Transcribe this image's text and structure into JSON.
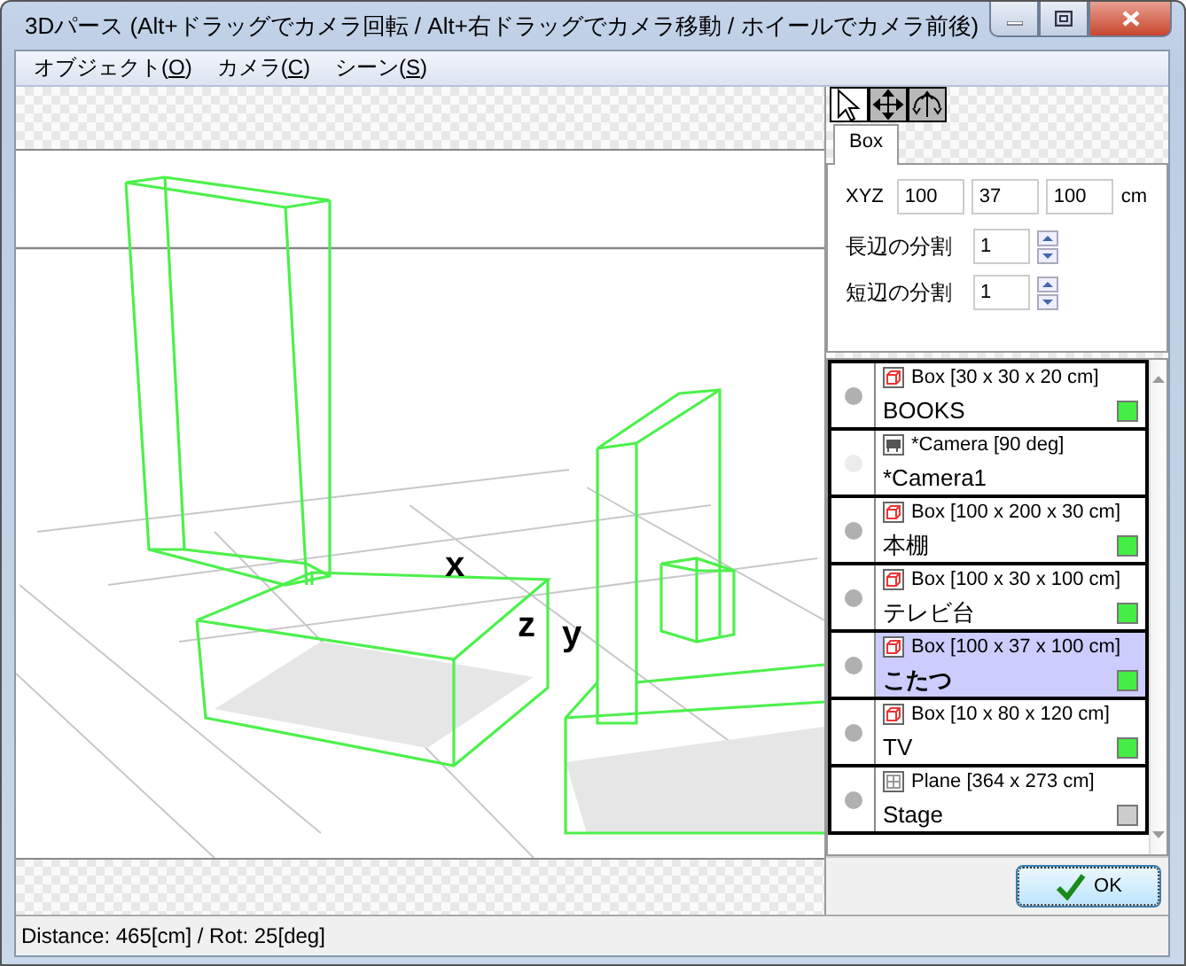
{
  "window": {
    "title": "3Dパース (Alt+ドラッグでカメラ回転 / Alt+右ドラッグでカメラ移動 / ホイールでカメラ前後)"
  },
  "menu": [
    {
      "before": "オブジェクト(",
      "key": "O",
      "after": ")"
    },
    {
      "before": "カメラ(",
      "key": "C",
      "after": ")"
    },
    {
      "before": "シーン(",
      "key": "S",
      "after": ")"
    }
  ],
  "viewport": {
    "axis_labels": [
      "x",
      "z",
      "y"
    ]
  },
  "tools": [
    {
      "kind": "select",
      "selected": true
    },
    {
      "kind": "move",
      "selected": false
    },
    {
      "kind": "rotate",
      "selected": false
    }
  ],
  "properties": {
    "tab": {
      "label": "Box",
      "selected": true
    },
    "xyz_label": "XYZ",
    "xyz": [
      "100",
      "37",
      "100"
    ],
    "unit": "cm",
    "spinners": [
      {
        "label": "長辺の分割",
        "value": "1"
      },
      {
        "label": "短辺の分割",
        "value": "1"
      }
    ]
  },
  "objects": [
    {
      "kind": "box",
      "title": "Box [30 x 30 x 20 cm]",
      "name": "BOOKS",
      "color": "#44ee44",
      "visible": true,
      "selected": false
    },
    {
      "kind": "camera",
      "title": "*Camera [90 deg]",
      "name": "*Camera1",
      "visible": false,
      "selected": false
    },
    {
      "kind": "box",
      "title": "Box [100 x 200 x 30 cm]",
      "name": "本棚",
      "color": "#44ee44",
      "visible": true,
      "selected": false
    },
    {
      "kind": "box",
      "title": "Box [100 x 30 x 100 cm]",
      "name": "テレビ台",
      "color": "#44ee44",
      "visible": true,
      "selected": false
    },
    {
      "kind": "box",
      "title": "Box [100 x 37 x 100 cm]",
      "name": "こたつ",
      "color": "#44ee44",
      "visible": true,
      "selected": true
    },
    {
      "kind": "box",
      "title": "Box [10 x 80 x 120 cm]",
      "name": "TV",
      "color": "#44ee44",
      "visible": true,
      "selected": false
    },
    {
      "kind": "plane",
      "title": "Plane [364 x 273 cm]",
      "name": "Stage",
      "color": "#cccccc",
      "visible": true,
      "selected": false
    }
  ],
  "ok_button": "OK",
  "status_bar": "Distance: 465[cm] / Rot: 25[deg]"
}
